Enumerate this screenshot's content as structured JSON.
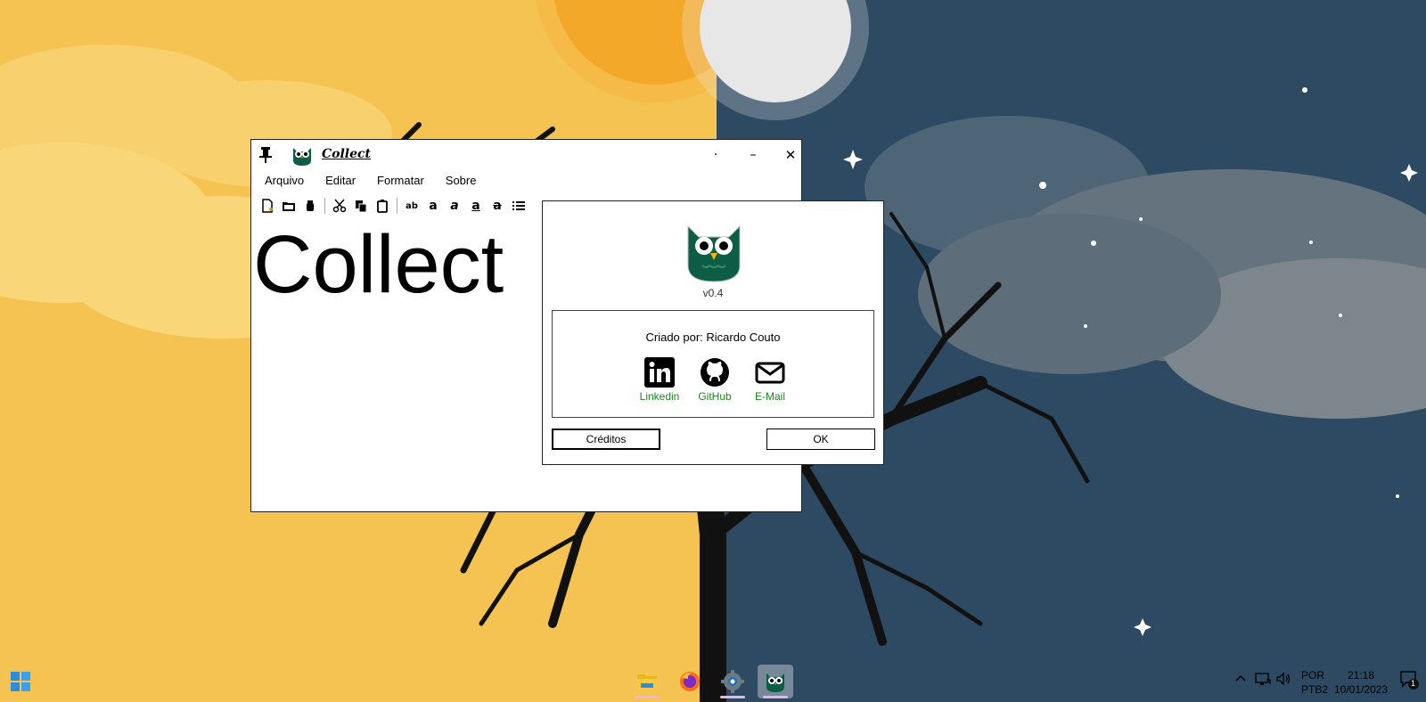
{
  "app": {
    "title": "Collect",
    "menu": [
      "Arquivo",
      "Editar",
      "Formatar",
      "Sobre"
    ],
    "window_buttons": {
      "extra": "·",
      "minimize": "–",
      "close": "✕"
    },
    "toolbar_text_buttons": [
      "ab",
      "a",
      "a",
      "a",
      "a"
    ],
    "editor_text": "Collect"
  },
  "about": {
    "version": "v0.4",
    "author": "Criado por: Ricardo Couto",
    "links": [
      {
        "label": "Linkedin",
        "icon": "linkedin-icon"
      },
      {
        "label": "GitHub",
        "icon": "github-icon"
      },
      {
        "label": "E-Mail",
        "icon": "mail-icon"
      }
    ],
    "credits_button": "Créditos",
    "ok_button": "OK",
    "link_color": "#1a8a1a",
    "logo_color": "#0d5c45"
  },
  "taskbar": {
    "apps": [
      "folder-icon",
      "firefox-icon",
      "settings-icon",
      "collect-app-icon"
    ],
    "language": {
      "line1": "POR",
      "line2": "PTB2"
    },
    "clock": {
      "time": "21:18",
      "date": "10/01/2023"
    },
    "notification_count": "1"
  },
  "colors": {
    "day_sky": "#f5c351",
    "night_sky": "#2e4a63",
    "sun": "#f29a10"
  }
}
